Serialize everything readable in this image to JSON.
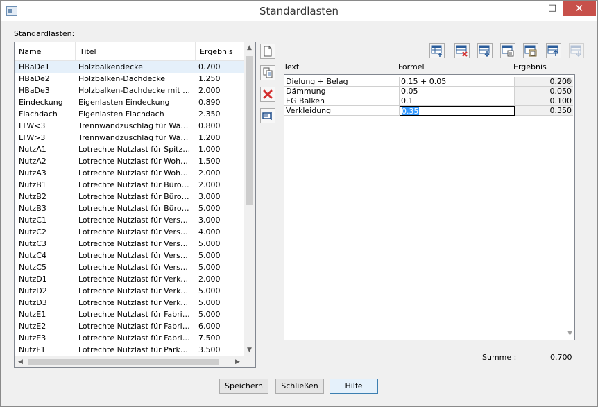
{
  "window": {
    "title": "Standardlasten",
    "min_glyph": "—",
    "max_glyph": "□",
    "close_glyph": "✕"
  },
  "list": {
    "group_label": "Standardlasten:",
    "headers": {
      "name": "Name",
      "titel": "Titel",
      "ergebnis": "Ergebnis"
    },
    "rows": [
      {
        "name": "HBaDe1",
        "titel": "Holzbalkendecke",
        "ergebnis": "0.700",
        "selected": true
      },
      {
        "name": "HBaDe2",
        "titel": "Holzbalken-Dachdecke",
        "ergebnis": "1.250"
      },
      {
        "name": "HBaDe3",
        "titel": "Holzbalken-Dachdecke mit Sch...",
        "ergebnis": "2.000"
      },
      {
        "name": "Eindeckung",
        "titel": "Eigenlasten Eindeckung",
        "ergebnis": "0.890"
      },
      {
        "name": "Flachdach",
        "titel": "Eigenlasten Flachdach",
        "ergebnis": "2.350"
      },
      {
        "name": "LTW<3",
        "titel": "Trennwandzuschlag für Wände...",
        "ergebnis": "0.800"
      },
      {
        "name": "LTW>3",
        "titel": "Trennwandzuschlag für Wände...",
        "ergebnis": "1.200"
      },
      {
        "name": "NutzA1",
        "titel": "Lotrechte Nutzlast für Spitzböden",
        "ergebnis": "1.000"
      },
      {
        "name": "NutzA2",
        "titel": "Lotrechte Nutzlast für Wohn- u...",
        "ergebnis": "1.500"
      },
      {
        "name": "NutzA3",
        "titel": "Lotrechte Nutzlast für Wohn- u...",
        "ergebnis": "2.000"
      },
      {
        "name": "NutzB1",
        "titel": "Lotrechte Nutzlast für Büroflác...",
        "ergebnis": "2.000"
      },
      {
        "name": "NutzB2",
        "titel": "Lotrechte Nutzlast für Büroflác...",
        "ergebnis": "3.000"
      },
      {
        "name": "NutzB3",
        "titel": "Lotrechte Nutzlast für Büroflác...",
        "ergebnis": "5.000"
      },
      {
        "name": "NutzC1",
        "titel": "Lotrechte Nutzlast für Versam...",
        "ergebnis": "3.000"
      },
      {
        "name": "NutzC2",
        "titel": "Lotrechte Nutzlast für Versam...",
        "ergebnis": "4.000"
      },
      {
        "name": "NutzC3",
        "titel": "Lotrechte Nutzlast für Versam...",
        "ergebnis": "5.000"
      },
      {
        "name": "NutzC4",
        "titel": "Lotrechte Nutzlast für Versam...",
        "ergebnis": "5.000"
      },
      {
        "name": "NutzC5",
        "titel": "Lotrechte Nutzlast für Versam...",
        "ergebnis": "5.000"
      },
      {
        "name": "NutzD1",
        "titel": "Lotrechte Nutzlast für Verkauf...",
        "ergebnis": "2.000"
      },
      {
        "name": "NutzD2",
        "titel": "Lotrechte Nutzlast für Verkauf...",
        "ergebnis": "5.000"
      },
      {
        "name": "NutzD3",
        "titel": "Lotrechte Nutzlast für Verkauf...",
        "ergebnis": "5.000"
      },
      {
        "name": "NutzE1",
        "titel": "Lotrechte Nutzlast für Fabriken...",
        "ergebnis": "5.000"
      },
      {
        "name": "NutzE2",
        "titel": "Lotrechte Nutzlast für Fabriken...",
        "ergebnis": "6.000"
      },
      {
        "name": "NutzE3",
        "titel": "Lotrechte Nutzlast für Fabriken...",
        "ergebnis": "7.500"
      },
      {
        "name": "NutzF1",
        "titel": "Lotrechte Nutzlast für Parkhäu...",
        "ergebnis": "3.500"
      }
    ]
  },
  "side_buttons": [
    {
      "name": "new-icon"
    },
    {
      "name": "copy-icon"
    },
    {
      "name": "delete-icon"
    },
    {
      "name": "edit-icon"
    }
  ],
  "toolbar": [
    {
      "name": "insert-row-icon"
    },
    {
      "name": "delete-row-icon"
    },
    {
      "name": "move-row-down-icon"
    },
    {
      "name": "copy-row-icon"
    },
    {
      "name": "paste-row-icon"
    },
    {
      "name": "move-row-up-icon"
    },
    {
      "name": "move-row-to-end-icon",
      "disabled": true
    }
  ],
  "grid": {
    "headers": {
      "text": "Text",
      "formel": "Formel",
      "ergebnis": "Ergebnis"
    },
    "rows": [
      {
        "text": "Dielung + Belag",
        "formel": "0.15 + 0.05",
        "ergebnis": "0.200"
      },
      {
        "text": "Dämmung",
        "formel": "0.05",
        "ergebnis": "0.050"
      },
      {
        "text": "EG Balken",
        "formel": "0.1",
        "ergebnis": "0.100"
      },
      {
        "text": "Verkleidung",
        "formel": "0.35",
        "ergebnis": "0.350",
        "editing": true
      }
    ],
    "scroll_up": "▲",
    "scroll_down": "▼"
  },
  "summary": {
    "label": "Summe :",
    "value": "0.700"
  },
  "buttons": {
    "save": "Speichern",
    "close": "Schließen",
    "help": "Hilfe"
  },
  "colors": {
    "accent": "#3399ff",
    "close_button": "#c7504a",
    "selection_row": "#e5f0fa",
    "delete_red": "#d32f2f"
  }
}
